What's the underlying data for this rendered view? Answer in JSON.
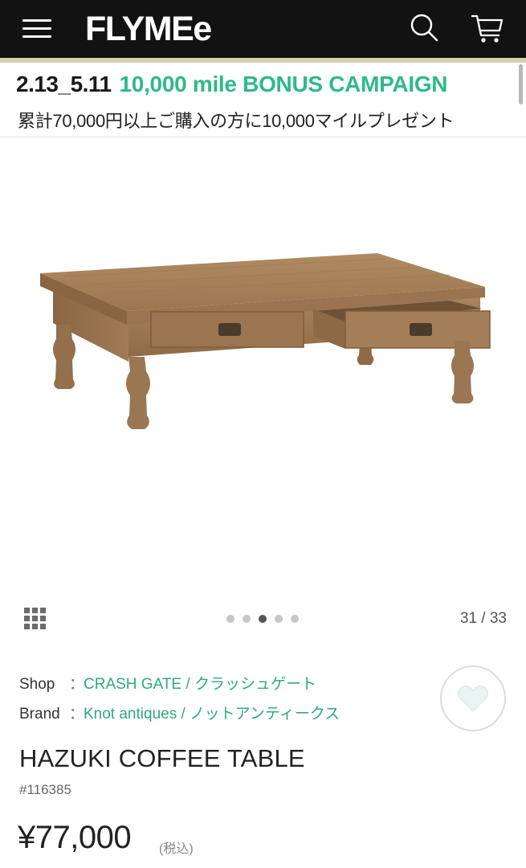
{
  "header": {
    "logo": "FLYMEe",
    "menu_icon": "hamburger-menu-icon",
    "search_icon": "search-icon",
    "cart_icon": "cart-icon",
    "background": "#121212"
  },
  "banner": {
    "dates": "2.13_5.11",
    "campaign": "10,000 mile BONUS CAMPAIGN",
    "subtext": "累計70,000円以上ご購入の方に10,000マイルプレゼント",
    "accent_color": "#2fb98a"
  },
  "gallery": {
    "grid_icon": "grid-view-icon",
    "dots_total": 5,
    "active_dot": 3,
    "counter": "31 / 33"
  },
  "product": {
    "shop_label": "Shop",
    "shop_separator": "：",
    "shop_value": "CRASH GATE / クラッシュゲート",
    "brand_label": "Brand",
    "brand_separator": "：",
    "brand_value": "Knot antiques / ノットアンティークス",
    "title": "HAZUKI COFFEE TABLE",
    "sku": "#116385",
    "price": "¥77,000",
    "tax_note": "(税込)",
    "favorite_icon": "heart-icon",
    "link_color": "#2fa882"
  }
}
